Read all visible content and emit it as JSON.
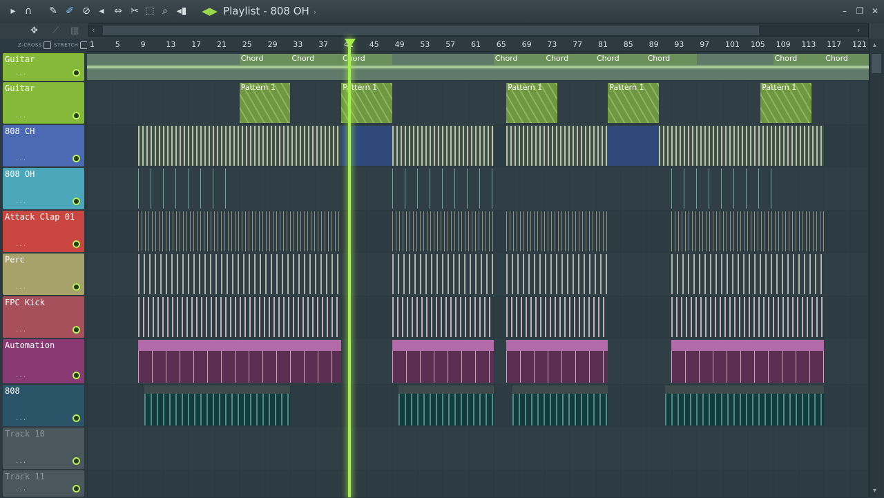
{
  "window": {
    "title": "Playlist - 808 OH",
    "minimize_icon": "minimize-icon",
    "restore_icon": "restore-icon",
    "close_icon": "close-icon"
  },
  "toolbar": {
    "tools": [
      "play-arrow-icon",
      "magnet-icon",
      "pencil-icon",
      "paint-icon",
      "delete-icon",
      "mute-icon",
      "slip-icon",
      "slice-icon",
      "select-icon",
      "zoom-icon",
      "playback-icon"
    ]
  },
  "options": {
    "zcross_label": "Z-CROSS",
    "stretch_label": "STRETCH"
  },
  "ruler": {
    "ticks": [
      "1",
      "5",
      "9",
      "13",
      "17",
      "21",
      "25",
      "29",
      "33",
      "37",
      "41",
      "45",
      "49",
      "53",
      "57",
      "61",
      "65",
      "69",
      "73",
      "77",
      "81",
      "85",
      "89",
      "93",
      "97",
      "101",
      "105",
      "109",
      "113",
      "117",
      "121"
    ]
  },
  "tracks": [
    {
      "name": "Guitar",
      "color": "#86b83a"
    },
    {
      "name": "Guitar",
      "color": "#86b83a"
    },
    {
      "name": "808 CH",
      "color": "#4c6ab3"
    },
    {
      "name": "808 OH",
      "color": "#4aa6b8"
    },
    {
      "name": "Attack Clap 01",
      "color": "#c8463f"
    },
    {
      "name": "Perc",
      "color": "#a6a26a"
    },
    {
      "name": "FPC Kick",
      "color": "#a84f5c"
    },
    {
      "name": "Automation",
      "color": "#8a3a72"
    },
    {
      "name": "808",
      "color": "#2c5468"
    },
    {
      "name": "Track 10",
      "color": "#4a575d"
    },
    {
      "name": "Track 11",
      "color": "#4a575d"
    }
  ],
  "clips": {
    "chord_label": "Chord",
    "pattern_label": "Pattern 1"
  },
  "colors": {
    "playhead": "#a6f04a",
    "accent": "#9ad84e"
  }
}
